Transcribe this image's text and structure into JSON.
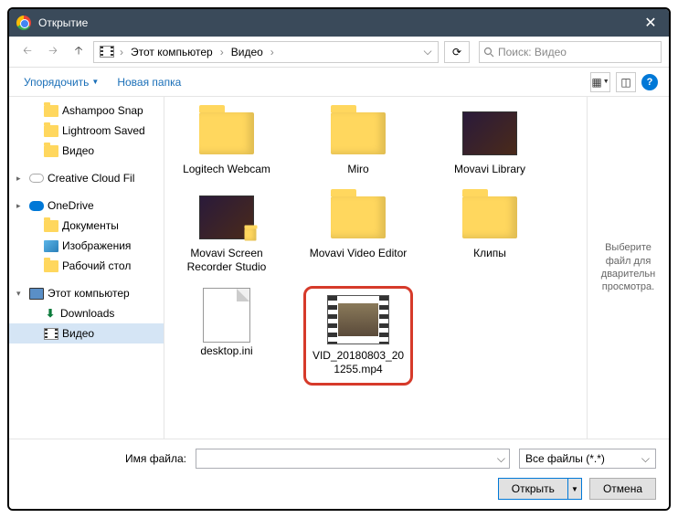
{
  "title": "Открытие",
  "breadcrumb": {
    "loc1": "Этот компьютер",
    "loc2": "Видео"
  },
  "search": {
    "placeholder": "Поиск: Видео"
  },
  "toolbar": {
    "organize": "Упорядочить",
    "newfolder": "Новая папка"
  },
  "sidebar": [
    {
      "label": "Ashampoo Snap",
      "icon": "folder",
      "indent": 1
    },
    {
      "label": "Lightroom Saved",
      "icon": "folder",
      "indent": 1
    },
    {
      "label": "Видео",
      "icon": "folder",
      "indent": 1
    },
    {
      "gap": true
    },
    {
      "label": "Creative Cloud Fil",
      "icon": "cloud",
      "indent": 0,
      "arrow": ">"
    },
    {
      "gap": true
    },
    {
      "label": "OneDrive",
      "icon": "onedrive",
      "indent": 0,
      "arrow": ">"
    },
    {
      "label": "Документы",
      "icon": "folder",
      "indent": 1
    },
    {
      "label": "Изображения",
      "icon": "img",
      "indent": 1
    },
    {
      "label": "Рабочий стол",
      "icon": "folder",
      "indent": 1
    },
    {
      "gap": true
    },
    {
      "label": "Этот компьютер",
      "icon": "pc",
      "indent": 0,
      "arrow": "v"
    },
    {
      "label": "Downloads",
      "icon": "dl",
      "indent": 1
    },
    {
      "label": "Видео",
      "icon": "vid",
      "indent": 1,
      "selected": true
    }
  ],
  "files": [
    {
      "label": "Logitech Webcam",
      "thumb": "folder"
    },
    {
      "label": "Miro",
      "thumb": "folder"
    },
    {
      "label": "Movavi Library",
      "thumb": "dark"
    },
    {
      "label": "Movavi Screen Recorder Studio",
      "thumb": "dark-folder"
    },
    {
      "label": "Movavi Video Editor",
      "thumb": "folder"
    },
    {
      "label": "Клипы",
      "thumb": "folder"
    },
    {
      "label": "desktop.ini",
      "thumb": "doc"
    },
    {
      "label": "VID_20180803_201255.mp4",
      "thumb": "video",
      "highlight": true
    }
  ],
  "preview": "Выберите файл для дварительн просмотра.",
  "bottom": {
    "fnlabel": "Имя файла:",
    "filter": "Все файлы (*.*)",
    "open": "Открыть",
    "cancel": "Отмена"
  }
}
